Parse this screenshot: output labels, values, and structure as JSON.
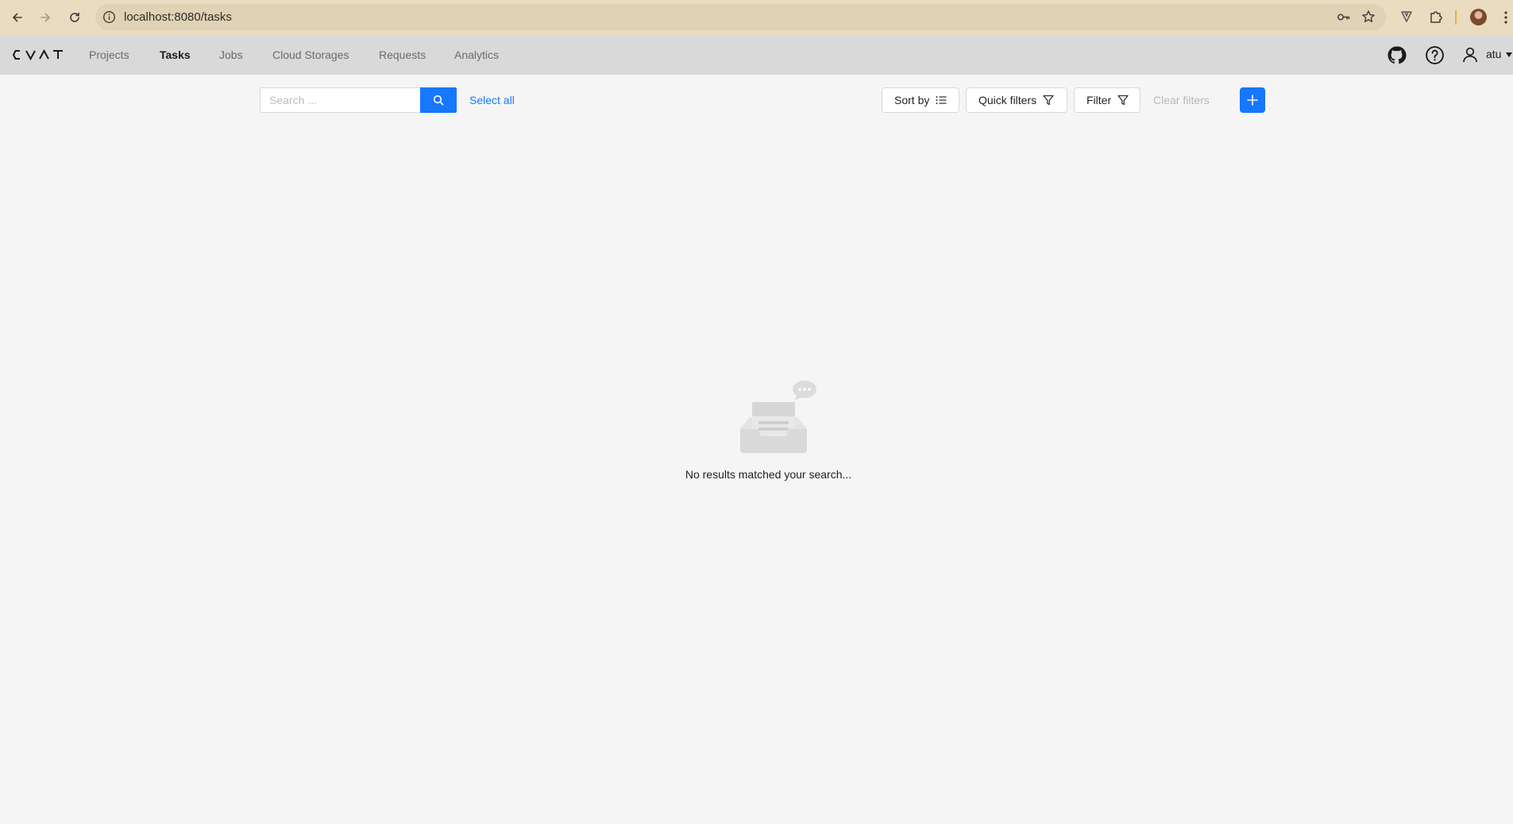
{
  "browser": {
    "url": "localhost:8080/tasks"
  },
  "header": {
    "logo_text": "CVAT",
    "nav": [
      {
        "label": "Projects"
      },
      {
        "label": "Tasks",
        "active": true
      },
      {
        "label": "Jobs"
      },
      {
        "label": "Cloud Storages"
      },
      {
        "label": "Requests"
      },
      {
        "label": "Analytics"
      }
    ],
    "user": "atu"
  },
  "toolbar": {
    "search_placeholder": "Search ...",
    "select_all": "Select all",
    "sort_by": "Sort by",
    "quick_filters": "Quick filters",
    "filter": "Filter",
    "clear_filters": "Clear filters"
  },
  "empty_state": {
    "message": "No results matched your search..."
  },
  "colors": {
    "accent": "#1677ff",
    "browser_bar": "#e9dcc0",
    "header_bg": "#d9d9d9",
    "page_bg": "#f5f5f5"
  },
  "icons": [
    "back-icon",
    "forward-icon",
    "reload-icon",
    "info-icon",
    "key-icon",
    "star-icon",
    "extension-icon",
    "puzzle-icon",
    "github-icon",
    "help-icon",
    "user-icon",
    "search-icon",
    "sort-icon",
    "filter-icon",
    "plus-icon",
    "empty-inbox-icon"
  ]
}
